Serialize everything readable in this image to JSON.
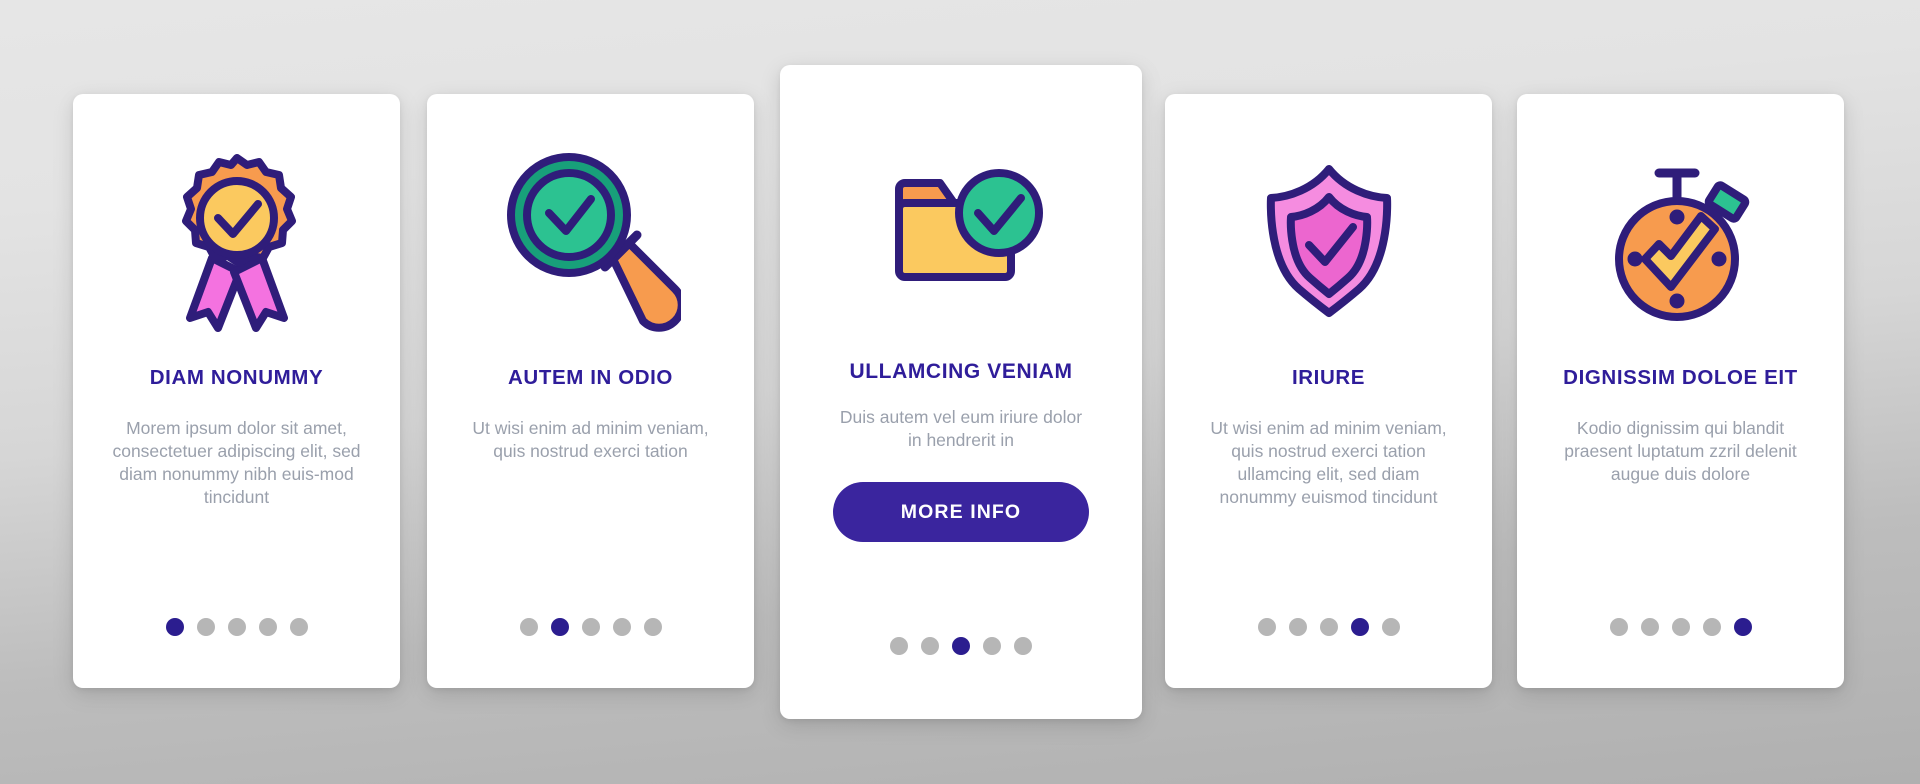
{
  "background": {
    "color_top": "#e6e6e6",
    "color_bottom": "#b0b0b0"
  },
  "palette": {
    "title": "#2f1d9a",
    "body_text": "#9aa0ac",
    "dot_active": "#2b1d8f",
    "dot_inactive": "#b6b6b6",
    "button_bg": "#3a259e",
    "button_text": "#ffffff",
    "outline": "#2f1d7a",
    "orange": "#f79b4e",
    "yellow": "#fbc95f",
    "pink": "#f472e0",
    "green": "#2cc291",
    "teal": "#18a07a",
    "magenta": "#ec66cf"
  },
  "cards": [
    {
      "id": "card-1",
      "icon": "award-badge-check-icon",
      "title": "DIAM NONUMMY",
      "body": "Morem ipsum dolor sit amet, consectetuer adipiscing elit, sed diam nonummy nibh euis-mod tincidunt",
      "dots": {
        "count": 5,
        "active_index": 0
      },
      "featured": false,
      "button": null
    },
    {
      "id": "card-2",
      "icon": "magnifier-check-icon",
      "title": "AUTEM IN ODIO",
      "body": "Ut wisi enim ad minim veniam, quis nostrud exerci tation",
      "dots": {
        "count": 5,
        "active_index": 1
      },
      "featured": false,
      "button": null
    },
    {
      "id": "card-3",
      "icon": "folder-check-icon",
      "title": "ULLAMCING VENIAM",
      "body": "Duis autem vel eum iriure dolor in hendrerit in",
      "dots": {
        "count": 5,
        "active_index": 2
      },
      "featured": true,
      "button": {
        "label": "MORE INFO"
      }
    },
    {
      "id": "card-4",
      "icon": "shield-check-icon",
      "title": "IRIURE",
      "body": "Ut wisi enim ad minim veniam, quis nostrud exerci tation ullamcing elit, sed diam nonummy euismod tincidunt",
      "dots": {
        "count": 5,
        "active_index": 3
      },
      "featured": false,
      "button": null
    },
    {
      "id": "card-5",
      "icon": "stopwatch-check-icon",
      "title": "DIGNISSIM DOLOE EIT",
      "body": "Kodio dignissim qui blandit praesent luptatum zzril delenit augue duis dolore",
      "dots": {
        "count": 5,
        "active_index": 4
      },
      "featured": false,
      "button": null
    }
  ]
}
